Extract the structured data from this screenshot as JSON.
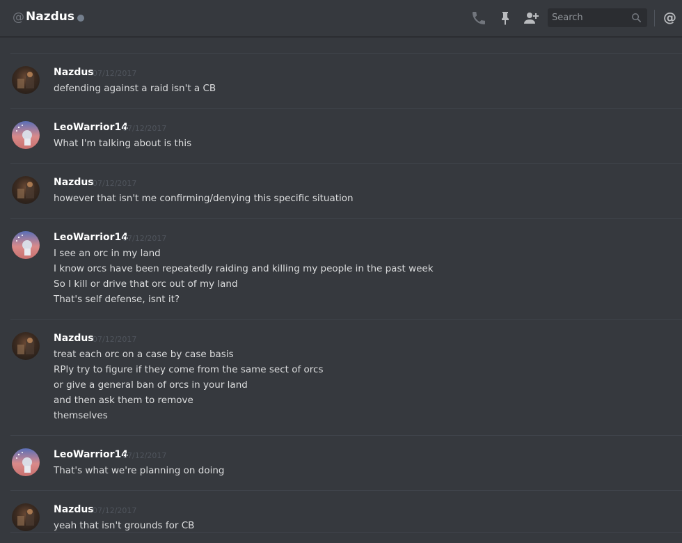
{
  "header": {
    "at_symbol": "@",
    "username": "Nazdus",
    "status": "offline",
    "icons": [
      "phone-icon",
      "pin-icon",
      "add-friend-icon",
      "search-icon",
      "mention-icon"
    ],
    "mention_glyph": "@",
    "search": {
      "placeholder": "Search"
    }
  },
  "colors": {
    "background": "#36393e",
    "username": "#ffffff",
    "message_text": "#dcddde",
    "timestamp": "#4f545c",
    "status_offline": "#747f8d"
  },
  "messages": [
    {
      "author": "Nazdus",
      "timestamp": "07/12/2017",
      "lines": [
        "defending against a raid isn't a CB"
      ]
    },
    {
      "author": "LeoWarrior14",
      "timestamp": "07/12/2017",
      "lines": [
        "What I'm talking about is this"
      ]
    },
    {
      "author": "Nazdus",
      "timestamp": "07/12/2017",
      "lines": [
        "however that isn't me confirming/denying this specific situation"
      ]
    },
    {
      "author": "LeoWarrior14",
      "timestamp": "07/12/2017",
      "lines": [
        "I see an orc in my land",
        "I know orcs have been repeatedly raiding and killing my people in the past week",
        "So I kill or drive that orc out of my land",
        "That's self defense, isnt it?"
      ]
    },
    {
      "author": "Nazdus",
      "timestamp": "07/12/2017",
      "lines": [
        "treat each orc on a case by case basis",
        "RPly try to figure if they come from the same sect of orcs",
        "or give a general ban of orcs in your land",
        "and then ask them to remove",
        "themselves"
      ]
    },
    {
      "author": "LeoWarrior14",
      "timestamp": "07/12/2017",
      "lines": [
        "That's what we're planning on doing"
      ]
    },
    {
      "author": "Nazdus",
      "timestamp": "07/12/2017",
      "lines": [
        "yeah that isn't grounds for CB"
      ]
    }
  ]
}
